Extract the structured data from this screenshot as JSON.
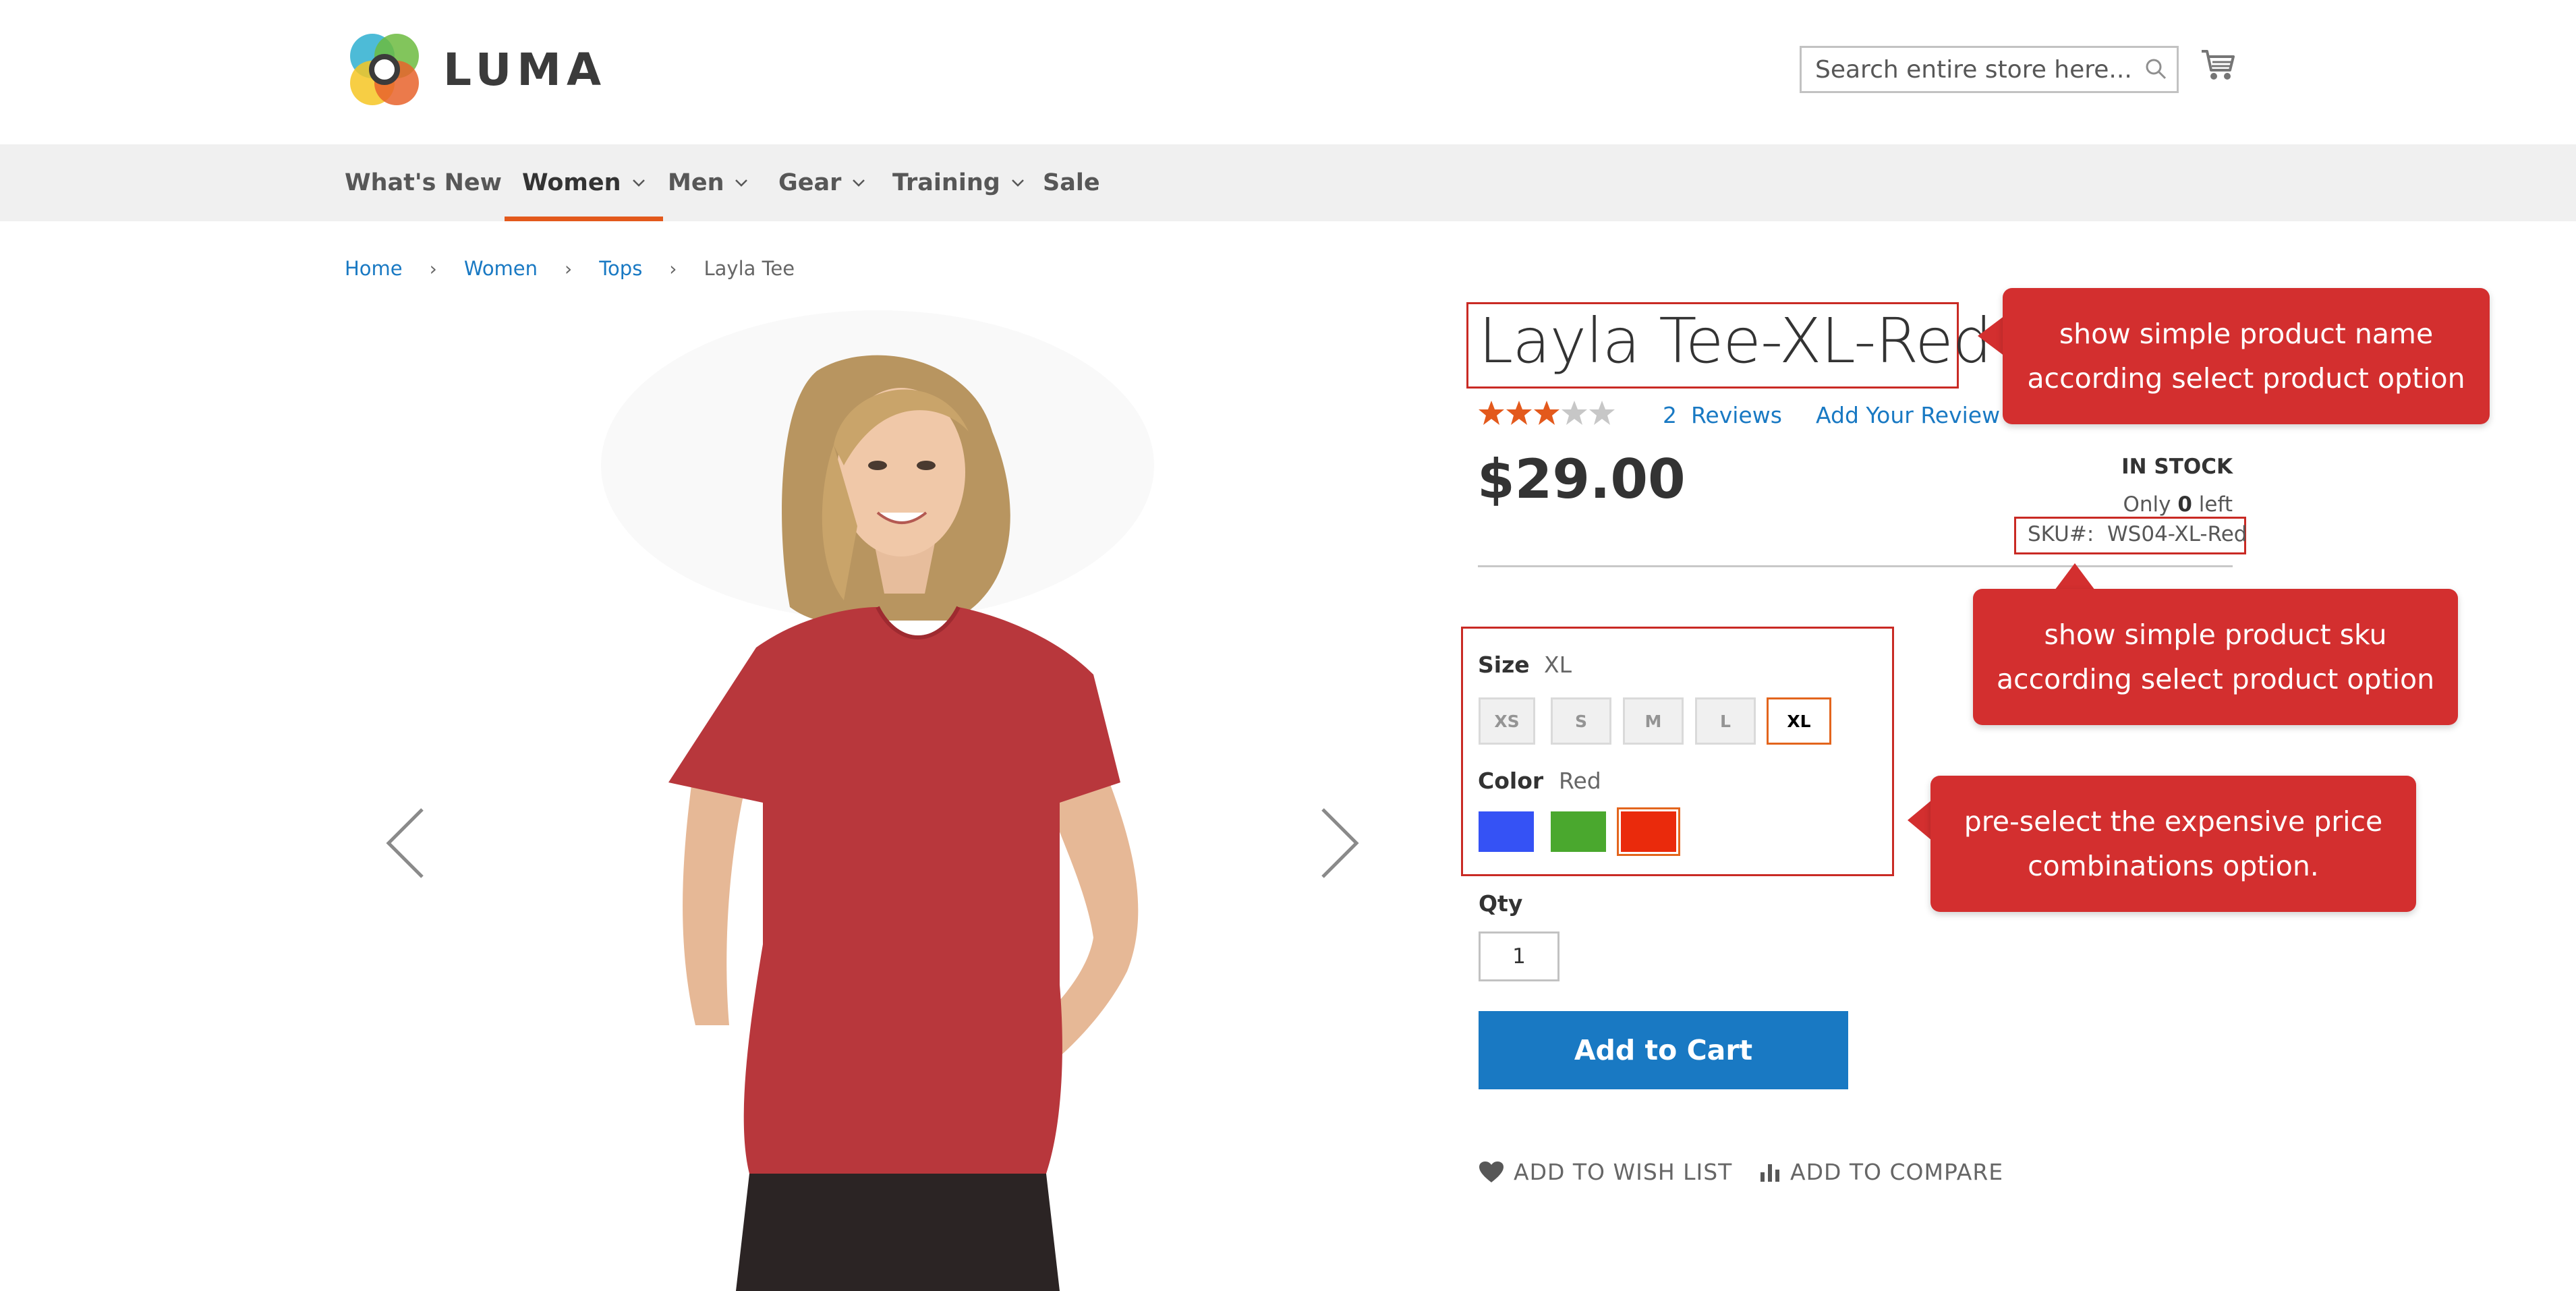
{
  "header": {
    "logo_text": "LUMA",
    "search_placeholder": "Search entire store here..."
  },
  "nav": {
    "items": [
      {
        "label": "What's New"
      },
      {
        "label": "Women"
      },
      {
        "label": "Men"
      },
      {
        "label": "Gear"
      },
      {
        "label": "Training"
      },
      {
        "label": "Sale"
      }
    ],
    "active": "Women"
  },
  "breadcrumbs": {
    "home": "Home",
    "women": "Women",
    "tops": "Tops",
    "current": "Layla Tee"
  },
  "product": {
    "title": "Layla Tee-XL-Red",
    "rating_stars": 3,
    "rating_max": 5,
    "reviews_count": "2",
    "reviews_label": "Reviews",
    "add_review": "Add Your Review",
    "price": "$29.00",
    "stock_status": "IN STOCK",
    "only_prefix": "Only",
    "only_count": "0",
    "only_suffix": "left",
    "sku_label": "SKU#:",
    "sku_value": "WS04-XL-Red",
    "size": {
      "label": "Size",
      "selected": "XL",
      "options": [
        "XS",
        "S",
        "M",
        "L",
        "XL"
      ]
    },
    "color": {
      "label": "Color",
      "selected": "Red",
      "options": [
        {
          "name": "Blue",
          "hex": "#3552f5"
        },
        {
          "name": "Green",
          "hex": "#4aa82e"
        },
        {
          "name": "Red",
          "hex": "#ea2a0c"
        }
      ]
    },
    "qty_label": "Qty",
    "qty_value": "1",
    "add_to_cart": "Add to Cart",
    "add_to_wishlist": "ADD TO WISH LIST",
    "add_to_compare": "ADD TO COMPARE"
  },
  "annotations": {
    "name_note": "show simple product name according select product option",
    "sku_note": "show simple product sku according select product option",
    "options_note": "pre-select the expensive price combinations option."
  },
  "colors": {
    "accent": "#e3591c",
    "link": "#1979c3",
    "callout": "#d32f2f",
    "star_on": "#e3591c",
    "star_off": "#c7c7c7"
  }
}
